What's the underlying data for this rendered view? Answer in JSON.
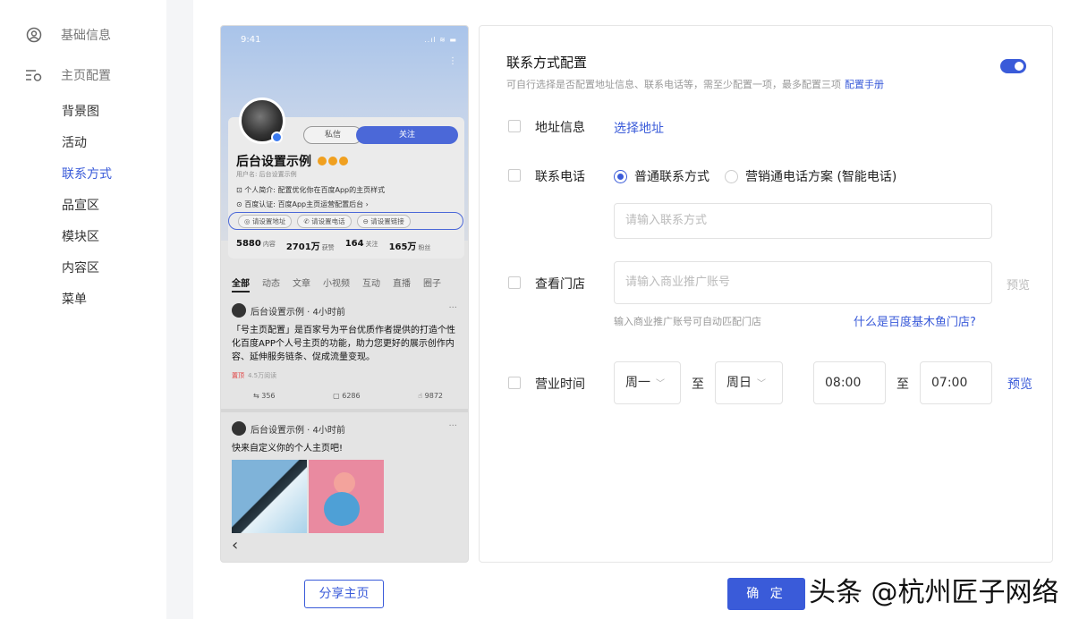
{
  "sidebar": {
    "groups": [
      {
        "label": "基础信息",
        "icon": "user-circle-icon"
      },
      {
        "label": "主页配置",
        "icon": "list-settings-icon"
      }
    ],
    "items": [
      {
        "label": "背景图"
      },
      {
        "label": "活动"
      },
      {
        "label": "联系方式"
      },
      {
        "label": "品宣区"
      },
      {
        "label": "模块区"
      },
      {
        "label": "内容区"
      },
      {
        "label": "菜单"
      }
    ],
    "active_item": "联系方式"
  },
  "preview": {
    "time": "9:41",
    "status": "..ıl ≋ ▬",
    "btn_message": "私信",
    "btn_follow": "关注",
    "name": "后台设置示例",
    "username": "用户名: 后台设置示例",
    "intro": "个人简介: 配置优化你在百度App的主页样式",
    "cert": "百度认证: 百度App主页运营配置后台 ›",
    "chips": [
      "请设置地址",
      "请设置电话",
      "请设置链接"
    ],
    "stats": [
      {
        "value": "5880",
        "label": "内容"
      },
      {
        "value": "2701万",
        "label": "获赞"
      },
      {
        "value": "164",
        "label": "关注"
      },
      {
        "value": "165万",
        "label": "粉丝"
      }
    ],
    "tabs": [
      "全部",
      "动态",
      "文章",
      "小视频",
      "互动",
      "直播",
      "圈子"
    ],
    "post1": {
      "author": "后台设置示例 · 4小时前",
      "text": "「号主页配置」是百家号为平台优质作者提供的打造个性化百度APP个人号主页的功能，助力您更好的展示创作内容、延伸服务链条、促成流量变现。",
      "tag": "置顶",
      "reads": "4.5万阅读",
      "shares": "356",
      "comments": "6286",
      "likes": "9872"
    },
    "post2": {
      "author": "后台设置示例 · 4小时前",
      "text": "快来自定义你的个人主页吧!"
    },
    "back": "‹"
  },
  "panel": {
    "title": "联系方式配置",
    "desc": "可自行选择是否配置地址信息、联系电话等，需至少配置一项，最多配置三项",
    "manual_link": "配置手册",
    "toggle_on": true,
    "address": {
      "label": "地址信息",
      "link": "选择地址"
    },
    "phone": {
      "label": "联系电话",
      "option1": "普通联系方式",
      "option2": "营销通电话方案 (智能电话)",
      "placeholder": "请输入联系方式"
    },
    "store": {
      "label": "查看门店",
      "placeholder": "请输入商业推广账号",
      "preview": "预览",
      "hint": "输入商业推广账号可自动匹配门店",
      "help_link": "什么是百度基木鱼门店?"
    },
    "hours": {
      "label": "营业时间",
      "day_from": "周一",
      "day_to": "周日",
      "time_from": "08:00",
      "time_to": "07:00",
      "to_label": "至",
      "preview": "预览"
    }
  },
  "footer": {
    "share_button": "分享主页",
    "confirm_button": "确 定"
  },
  "watermark": "头条 @杭州匠子网络",
  "colors": {
    "accent": "#3a5bd9"
  }
}
